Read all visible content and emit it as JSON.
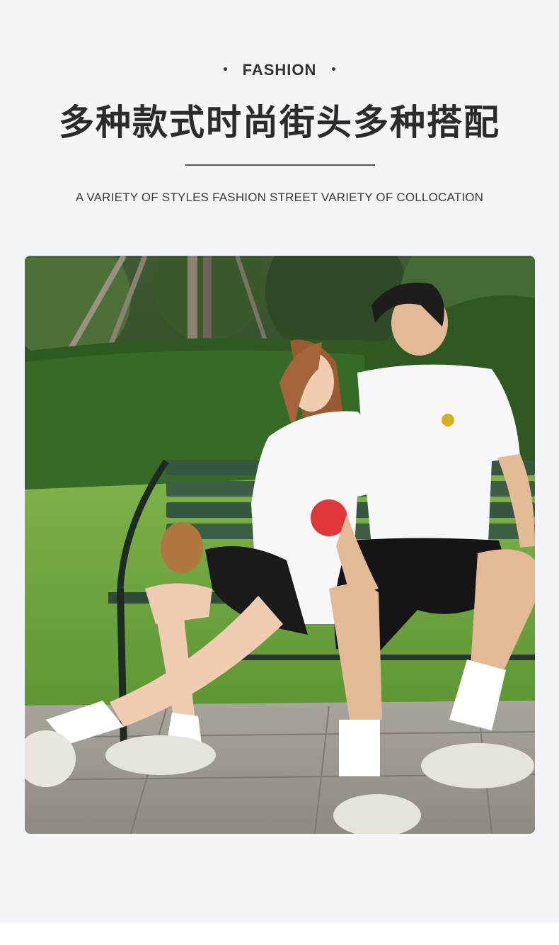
{
  "header": {
    "eyebrow": "FASHION",
    "headline": "多种款式时尚街头多种搭配",
    "subline": "A VARIETY OF STYLES FASHION STREET VARIETY OF COLLOCATION"
  },
  "colors": {
    "background": "#f4f5f9",
    "text": "#2b2b2b",
    "rule": "#555555"
  },
  "photo": {
    "subject": "couple in white t-shirts and black shorts sitting on a park bench"
  }
}
